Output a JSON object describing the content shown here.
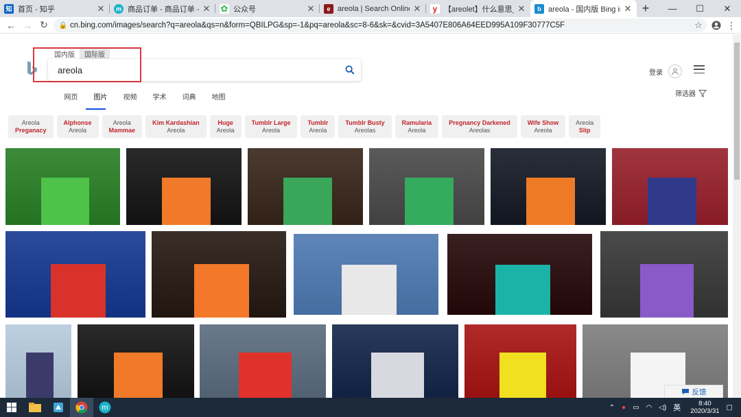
{
  "browser": {
    "tabs": [
      {
        "title": "首页 - 知乎",
        "favicon": "zhihu-icon",
        "color": "#0a66c2",
        "glyph": "知"
      },
      {
        "title": "商品订单 - 商品订单 - 订单管",
        "favicon": "m-icon",
        "color": "#1bb3c8",
        "glyph": "m"
      },
      {
        "title": "公众号",
        "favicon": "wechat-icon",
        "color": "#2db84b",
        "glyph": "◎"
      },
      {
        "title": "areola | Search Online Ety",
        "favicon": "dictionary-icon",
        "color": "#8b1a1a",
        "glyph": "e"
      },
      {
        "title": "【areolet】什么意思_英语a",
        "favicon": "youdao-icon",
        "color": "#e2231a",
        "glyph": "y"
      },
      {
        "title": "areola - 国内版 Bing images",
        "favicon": "bing-icon",
        "color": "#1a8ccf",
        "glyph": "b"
      }
    ],
    "url": "cn.bing.com/images/search?q=areola&qs=n&form=QBILPG&sp=-1&pq=areola&sc=8-6&sk=&cvid=3A5407E806A64EED995A109F30777C5F"
  },
  "bing": {
    "market_tabs": [
      "国内版",
      "国际版"
    ],
    "query": "areola",
    "signin": "登录",
    "verticals": [
      "网页",
      "图片",
      "视频",
      "学术",
      "词典",
      "地图"
    ],
    "active_vertical": 1,
    "filter_label": "筛选器",
    "related": [
      {
        "line1": "Areola",
        "line2": "Preganacy",
        "bold": 2
      },
      {
        "line1": "Alphonse",
        "line2": "Areola",
        "bold": 1
      },
      {
        "line1": "Areola",
        "line2": "Mammae",
        "bold": 2
      },
      {
        "line1": "Kim Kardashian",
        "line2": "Areola",
        "bold": 1
      },
      {
        "line1": "Huge",
        "line2": "Areola",
        "bold": 1
      },
      {
        "line1": "Tumblr Large",
        "line2": "Areola",
        "bold": 1
      },
      {
        "line1": "Tumblr",
        "line2": "Areola",
        "bold": 1
      },
      {
        "line1": "Tumblr Busty",
        "line2": "Areolas",
        "bold": 1
      },
      {
        "line1": "Ramularia",
        "line2": "Areola",
        "bold": 1
      },
      {
        "line1": "Pregnancy Darkened",
        "line2": "Areolas",
        "bold": 1
      },
      {
        "line1": "Wife Show",
        "line2": "Areola",
        "bold": 1
      },
      {
        "line1": "Areola",
        "line2": "Slip",
        "bold": 2
      }
    ],
    "feedback": "反馈"
  },
  "taskbar": {
    "ime": "英",
    "time": "8:40",
    "date": "2020/3/31"
  },
  "images": [
    {
      "jersey": "#4fc24a",
      "bg": "#3c8b3a"
    },
    {
      "jersey": "#f07a2a",
      "bg": "#2a2a2a"
    },
    {
      "jersey": "#3aa65a",
      "bg": "#4a3a30"
    },
    {
      "jersey": "#35ab5e",
      "bg": "#5a5a5a"
    },
    {
      "jersey": "#ef7a26",
      "bg": "#2a2f3a"
    },
    {
      "jersey": "#2f3a8a",
      "bg": "#a03540"
    },
    {
      "jersey": "#d8322b",
      "bg": "#2b4a9a"
    },
    {
      "jersey": "#f3782a",
      "bg": "#3a2e28"
    },
    {
      "jersey": "#e8e8e8",
      "bg": "#5f86b8"
    },
    {
      "jersey": "#1bb3a8",
      "bg": "#3a2020"
    },
    {
      "jersey": "#8a5ac8",
      "bg": "#4a4a4a"
    },
    {
      "jersey": "#3b3b6a",
      "bg": "#bcd0e2"
    },
    {
      "jersey": "#f07a2a",
      "bg": "#2a2a2a"
    },
    {
      "jersey": "#e0322a",
      "bg": "#6a7a8a"
    },
    {
      "jersey": "#d8d8e0",
      "bg": "#2a3a5a"
    },
    {
      "jersey": "#f0e020",
      "bg": "#b02a2a"
    },
    {
      "jersey": "#f4f4f4",
      "bg": "#8a8a8a"
    }
  ]
}
